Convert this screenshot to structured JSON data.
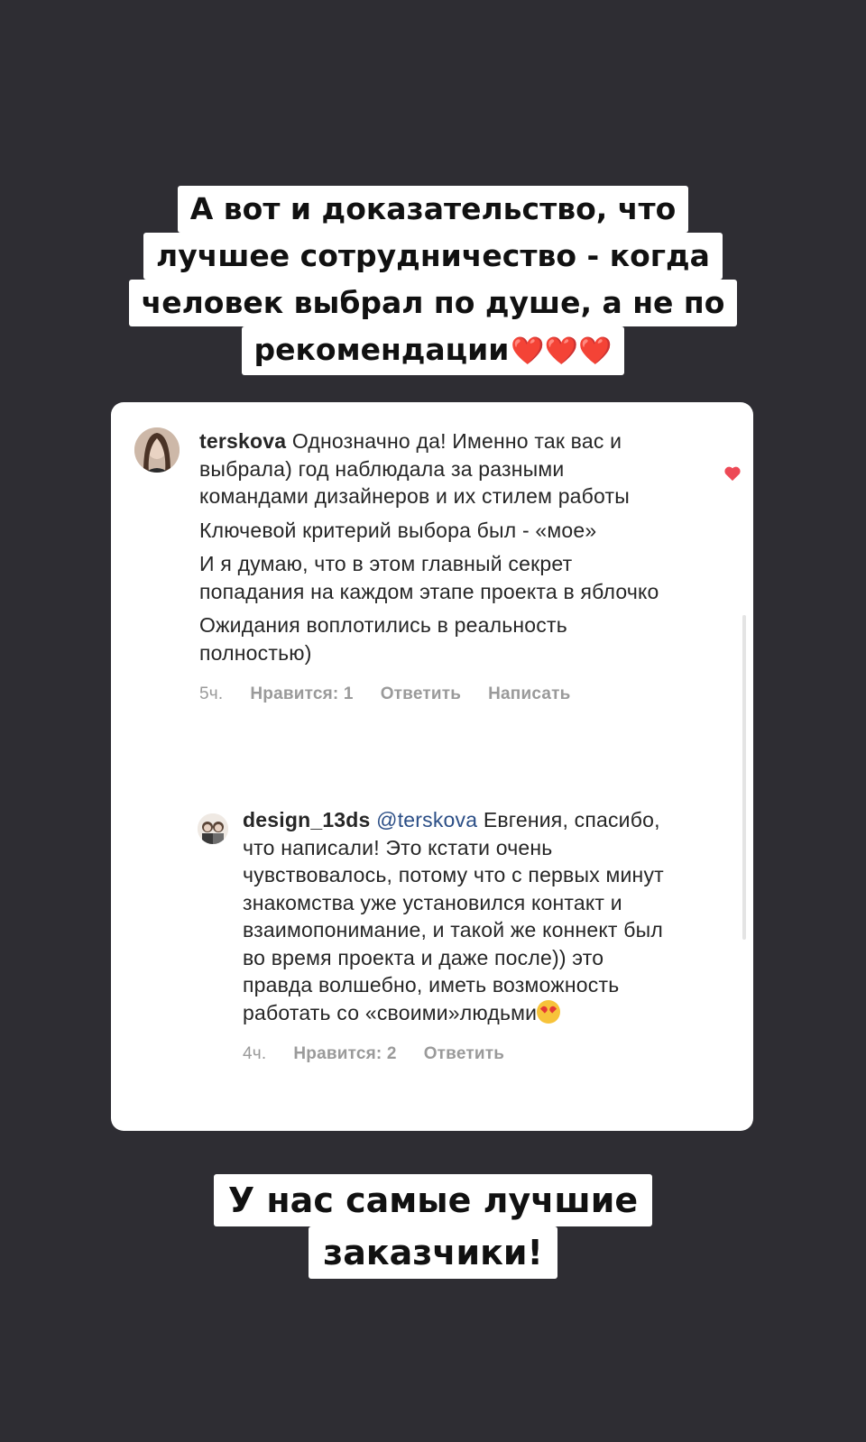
{
  "caption_top": {
    "lines": [
      "А вот и доказательство, что",
      "лучшее сотрудничество - когда",
      "человек выбрал по душе, а не по",
      "рекомендации"
    ],
    "hearts": "❤️❤️❤️"
  },
  "comments": [
    {
      "username": "terskova",
      "paragraphs": [
        "Однозначно да! Именно так вас и выбрала) год наблюдала за разными командами дизайнеров и их стилем работы",
        "Ключевой критерий выбора был - «мое»",
        "И я думаю, что в этом главный секрет попадания на каждом этапе проекта в яблочко",
        "Ожидания воплотились в реальность полностью)"
      ],
      "time": "5ч.",
      "likes": "Нравится: 1",
      "reply": "Ответить",
      "message": "Написать",
      "liked": true
    },
    {
      "username": "design_13ds",
      "mention": "@terskova",
      "text": "Евгения, спасибо, что написали! Это кстати очень чувствовалось, потому что с первых минут знакомства уже установился контакт и взаимопонимание, и такой же коннект был во время проекта и даже после)) это правда волшебно, иметь возможность работать со «своими»людьми",
      "time": "4ч.",
      "likes": "Нравится: 2",
      "reply": "Ответить",
      "liked": false
    }
  ],
  "caption_bottom": {
    "lines": [
      "У нас самые лучшие",
      "заказчики!"
    ]
  },
  "colors": {
    "background": "#2e2d33",
    "card": "#ffffff",
    "like_red": "#ed4956",
    "mention_blue": "#2b4e86",
    "meta_gray": "#9a9a9a"
  },
  "icons": [
    "heart-filled-icon",
    "heart-outline-icon",
    "heart-eyes-emoji"
  ]
}
